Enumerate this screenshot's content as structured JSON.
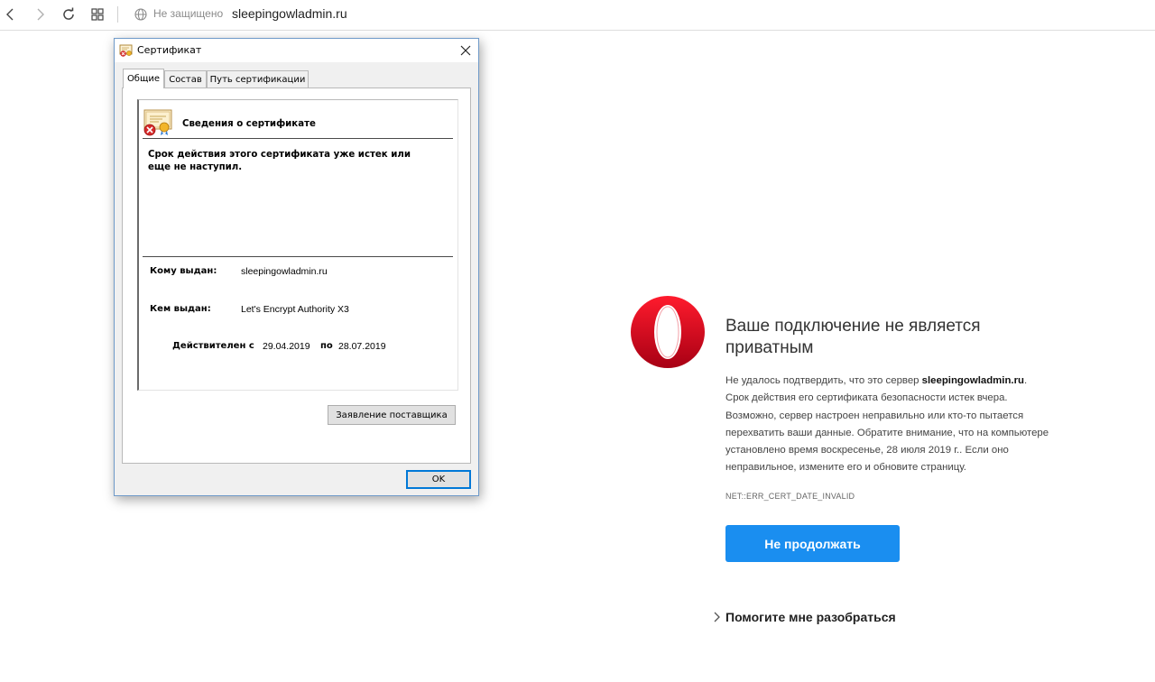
{
  "browser": {
    "security_label": "Не защищено",
    "url": "sleepingowladmin.ru"
  },
  "error_page": {
    "title": "Ваше подключение не является приватным",
    "description_prefix": "Не удалось подтвердить, что это сервер ",
    "description_domain": "sleepingowladmin.ru",
    "description_suffix": ". Срок действия его сертификата безопасности истек вчера. Возможно, сервер настроен неправильно или кто-то пытается перехватить ваши данные. Обратите внимание, что на компьютере установлено время воскресенье, 28 июля 2019 г.. Если оно неправильное, измените его и обновите страницу.",
    "error_code": "NET::ERR_CERT_DATE_INVALID",
    "back_button": "Не продолжать",
    "help_link": "Помогите мне разобраться",
    "accent_color": "#1a8ef0"
  },
  "dialog": {
    "title": "Сертификат",
    "tabs": [
      {
        "label": "Общие",
        "active": true
      },
      {
        "label": "Состав",
        "active": false
      },
      {
        "label": "Путь сертификации",
        "active": false
      }
    ],
    "info_heading": "Сведения о сертификате",
    "warning": "Срок действия этого сертификата уже истек или еще не наступил.",
    "issued_to_label": "Кому выдан:",
    "issued_to_value": "sleepingowladmin.ru",
    "issued_by_label": "Кем выдан:",
    "issued_by_value": "Let's Encrypt Authority X3",
    "valid_from_label": "Действителен с",
    "valid_from_value": "29.04.2019",
    "valid_to_label": "по",
    "valid_to_value": "28.07.2019",
    "issuer_statement_button": "Заявление поставщика",
    "ok_button": "OK"
  }
}
